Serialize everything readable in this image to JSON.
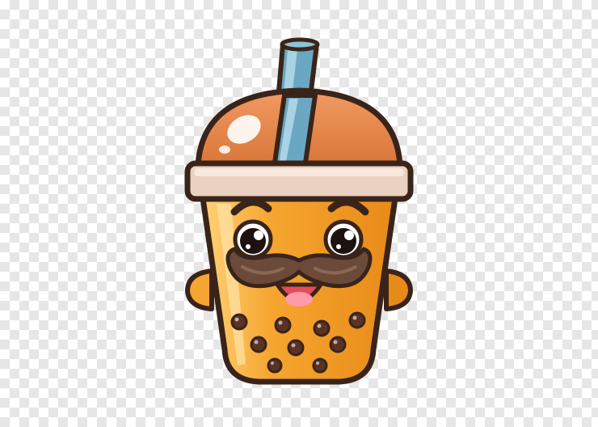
{
  "image": {
    "background": "transparent-checkerboard",
    "subject": "bubble-tea-cup-character",
    "colors": {
      "outline": "#3a2419",
      "tea": "#f4a02c",
      "tea_light": "#ffcf73",
      "dome": "#e8884c",
      "dome_highlight": "#ffffff",
      "rim": "#ead1c2",
      "straw": "#6aa7c2",
      "straw_light": "#a9d3e3",
      "mustache": "#6b4a3a",
      "mouth": "#e64b5c",
      "tongue": "#ff9aa8",
      "pearl": "#5a3325",
      "checker_light": "#ffffff",
      "checker_dark": "#e6e6e6"
    },
    "features": [
      "dome-lid",
      "straw",
      "eyes",
      "eyebrows",
      "mustache",
      "smiling-mouth",
      "arms",
      "tapioca-pearls"
    ]
  }
}
